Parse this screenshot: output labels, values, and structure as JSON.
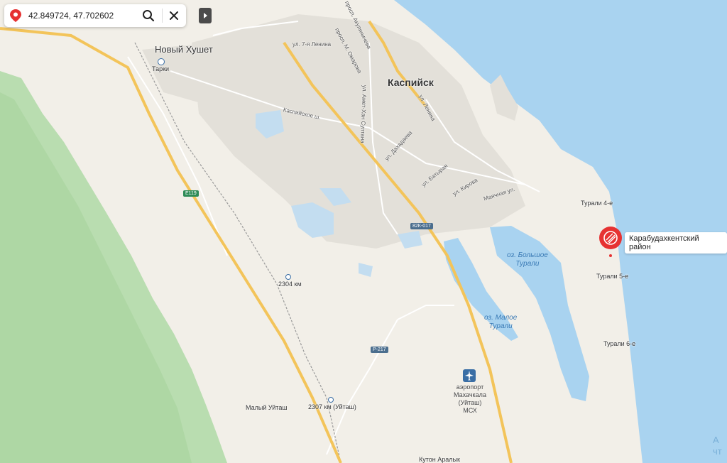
{
  "search": {
    "value": "42.849724, 47.702602",
    "pin_icon": "map-pin-icon",
    "search_icon": "search-icon",
    "close_icon": "close-icon"
  },
  "marker": {
    "label": "Карабудахкентский район",
    "color": "#e63232",
    "icon": "district-marker-icon"
  },
  "settlements": {
    "novyy_khushet": "Новый Хушет",
    "kaspiysk": "Каспийск",
    "turali4": "Турали 4-е",
    "turali5": "Турали 5-е",
    "turali6": "Турали 6-е",
    "malyy_uytash": "Малый Уйташ",
    "kuton_aralyk": "Кутон Аралык"
  },
  "lakes": {
    "bolshoe_l1": "оз. Большое",
    "bolshoe_l2": "Турали",
    "maloe_l1": "оз. Малое",
    "maloe_l2": "Турали"
  },
  "stations": {
    "tarki": "Тарки",
    "km2304": "2304 км",
    "km2307": "2307 км (Уйташ)"
  },
  "airport": {
    "line1": "аэропорт",
    "line2": "Махачкала",
    "line3": "(Уйташ)",
    "line4": "МСХ"
  },
  "streets": {
    "kaspiyskoe": "Каспийское ш.",
    "lenina7": "ул. 7-я Ленина",
    "omarova": "просп. М. Омарова",
    "amet_khan": "ул. Амет-Хан Султана",
    "abubakarova": "просп. Акулиничева",
    "dakhadaeva": "ул. Дахадаева",
    "lenina": "ул. Ленина",
    "batyrayа": "ул. Батырая",
    "kirova": "ул. Кирова",
    "mayachnaya": "Маячная ул."
  },
  "roads": {
    "e119": "E119",
    "r217a": "82К-017",
    "r217b": "Р-217"
  },
  "watermark": {
    "line1": "А",
    "line2": "чт"
  },
  "colors": {
    "land": "#f2efe8",
    "sea": "#a9d3f0",
    "forest": "#b9ddb0",
    "road_major": "#f3c45a",
    "urban": "#e3e0d9"
  }
}
